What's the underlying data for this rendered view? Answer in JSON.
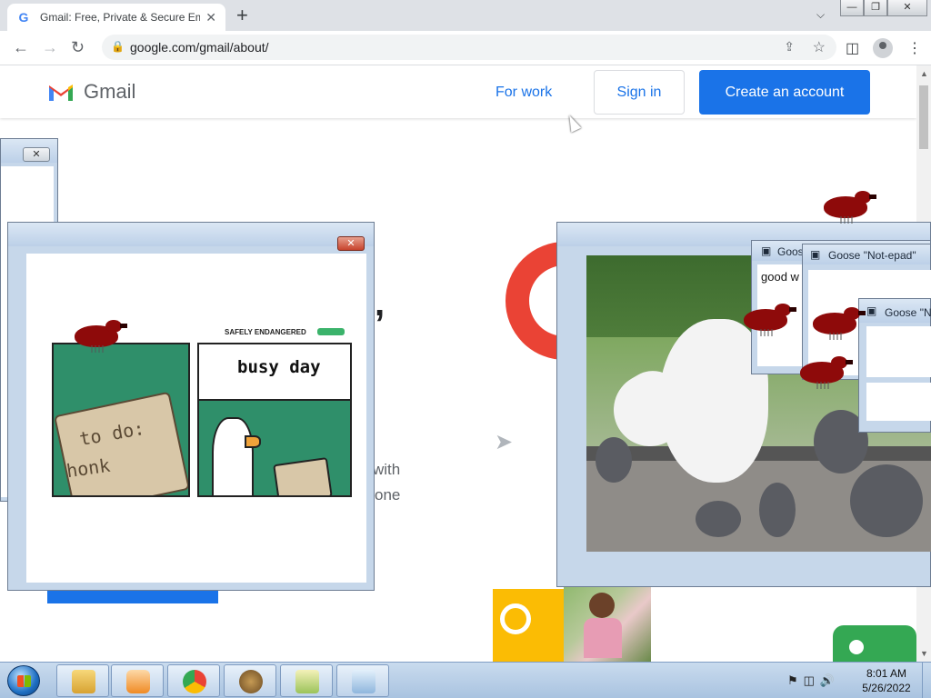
{
  "browser": {
    "tab_title": "Gmail: Free, Private & Secure Em",
    "tab_favicon": "G",
    "url": "google.com/gmail/about/",
    "new_tab_symbol": "+",
    "close_symbol": "✕"
  },
  "gmail": {
    "logo_text": "Gmail",
    "for_work": "For work",
    "sign_in": "Sign in",
    "create_account": "Create an account",
    "body_text_with": "with",
    "body_text_one": "one",
    "comma": ","
  },
  "goose_windows": {
    "notepad_1_title": "Goos",
    "notepad_1_text": "good w",
    "notepad_2_title": "Goose \"Not-epad\"",
    "notepad_3_title": "Goose \"N"
  },
  "comic": {
    "brand": "SAFELY ENDANGERED",
    "bubble_text": "busy day",
    "scroll_line_1": "to do:",
    "scroll_line_2": "honk"
  },
  "taskbar": {
    "time": "8:01 AM",
    "date": "5/26/2022"
  },
  "colors": {
    "gmail_blue": "#1a73e8",
    "gmail_red": "#ea4335",
    "goose_red": "#8e0a0a",
    "comic_green": "#2f8f6a"
  }
}
